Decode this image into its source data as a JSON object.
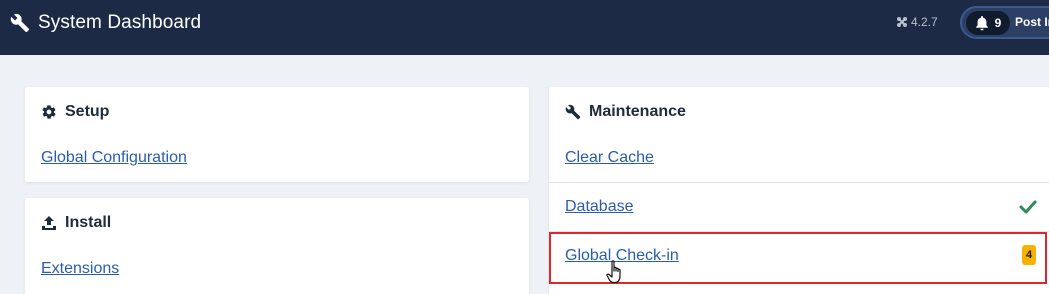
{
  "header": {
    "title": "System Dashboard",
    "version": "4.2.7",
    "notifications_count": "9",
    "post_label": "Post In",
    "icons": {
      "title": "wrench-icon",
      "version": "joomla-icon",
      "notifications": "bell-icon"
    }
  },
  "setup": {
    "title": "Setup",
    "icon": "gear-icon",
    "links": [
      "Global Configuration"
    ]
  },
  "install": {
    "title": "Install",
    "icon": "upload-icon",
    "links": [
      "Extensions"
    ]
  },
  "maintenance": {
    "title": "Maintenance",
    "icon": "wrench-icon",
    "items": [
      {
        "label": "Clear Cache"
      },
      {
        "label": "Database",
        "status": "check-icon"
      },
      {
        "label": "Global Check-in",
        "badge": "4"
      }
    ]
  },
  "colors": {
    "header_bg": "#1c2a46",
    "link": "#2a5db0",
    "success": "#2e8b57",
    "badge": "#f5b300",
    "highlight": "#e0262b"
  }
}
